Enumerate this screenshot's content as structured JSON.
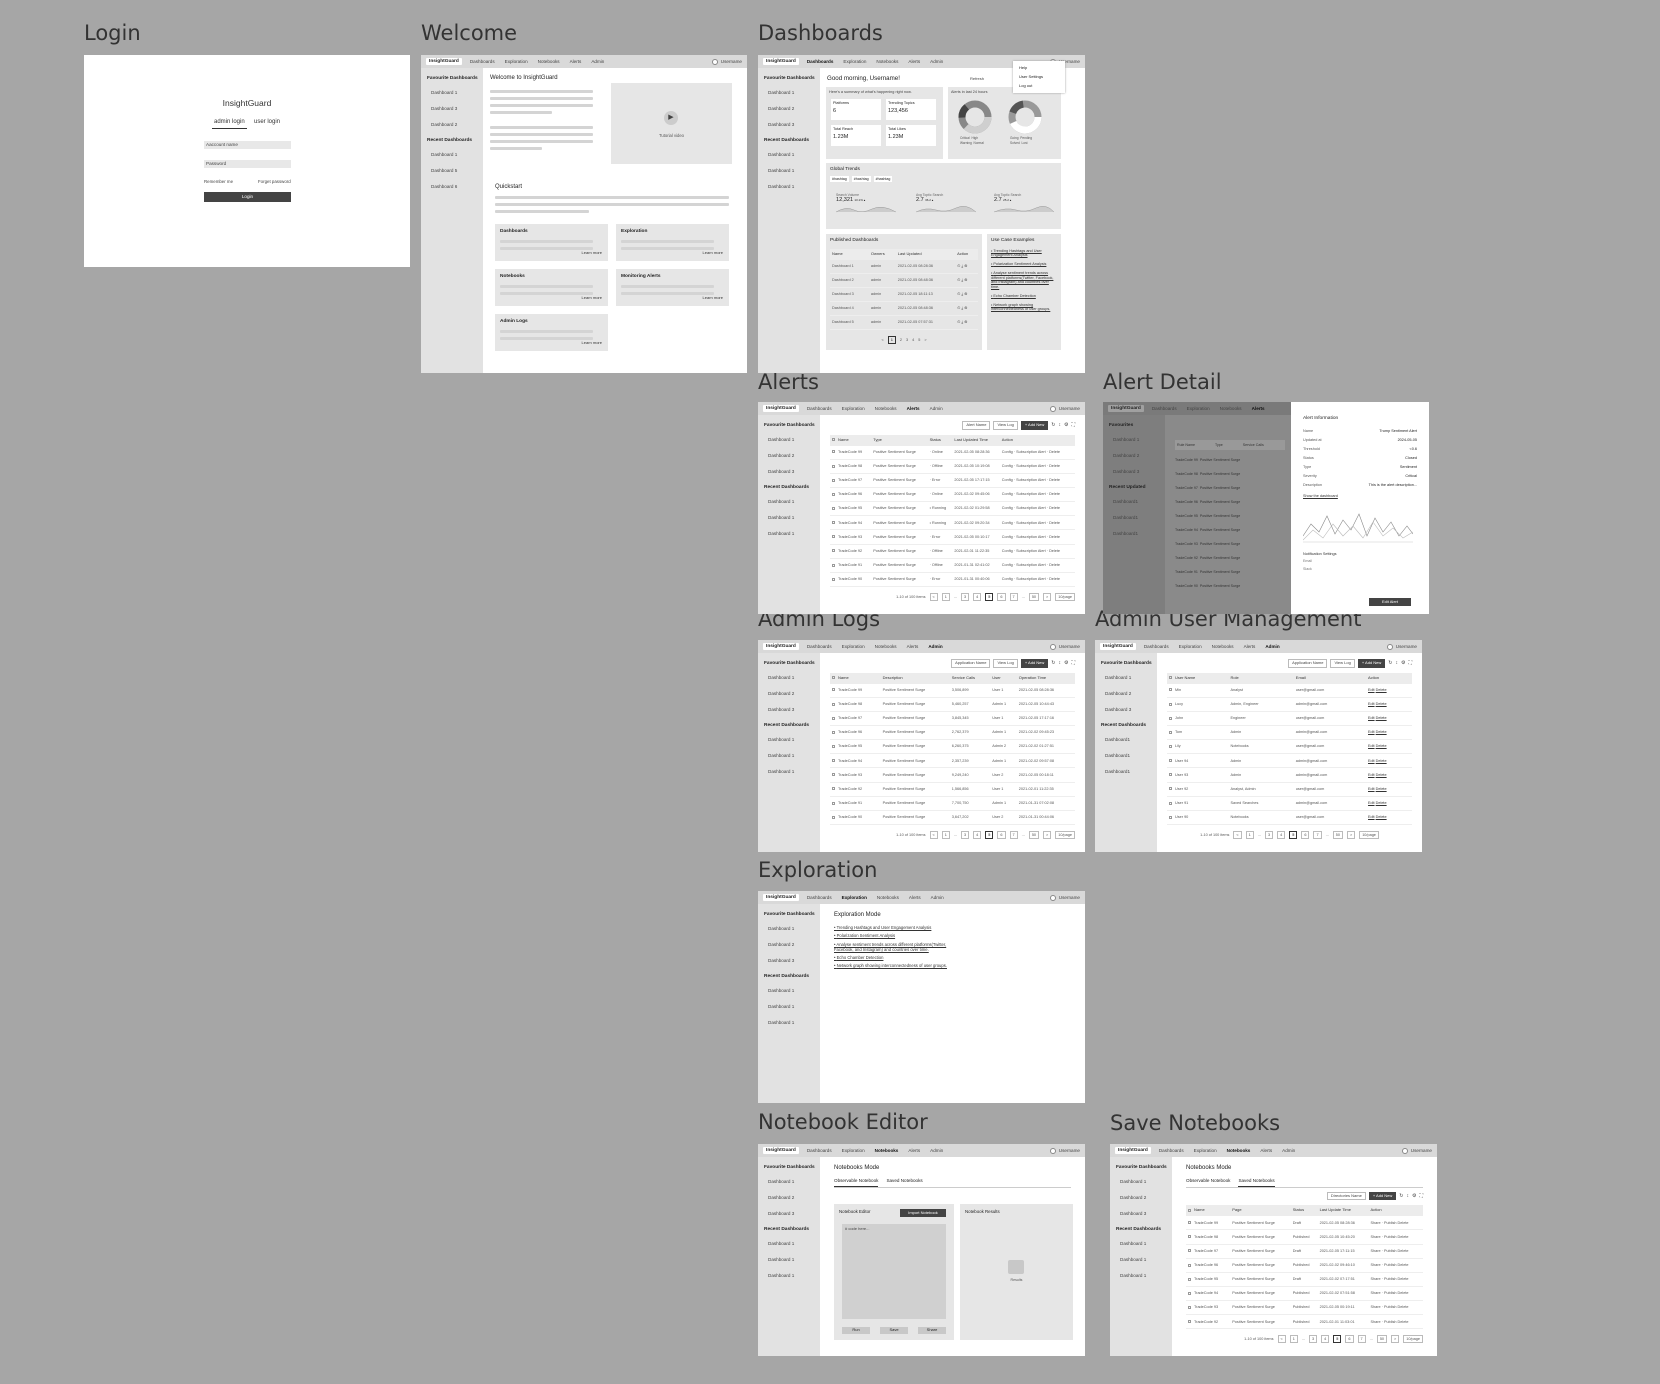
{
  "labels": {
    "login": "Login",
    "welcome": "Welcome",
    "dashboards": "Dashboards",
    "alerts": "Alerts",
    "alert_detail": "Alert Detail",
    "admin_logs": "Admin Logs",
    "admin_users": "Admin User Management",
    "exploration": "Exploration",
    "notebook_editor": "Notebook Editor",
    "save_notebooks": "Save Notebooks"
  },
  "app": {
    "name": "InsightGuard",
    "nav": [
      "Dashboards",
      "Exploration",
      "Notebooks",
      "Alerts",
      "Admin"
    ],
    "user": "Username"
  },
  "sidebar": {
    "fav_head": "Favourite Dashboards",
    "fav": [
      "Dashboard 1",
      "Dashboard 2",
      "Dashboard 3"
    ],
    "recent_head": "Recent Dashboards",
    "recent": [
      "Dashboard 1",
      "Dashboard 1",
      "Dashboard 1"
    ]
  },
  "login": {
    "title": "InsightGuard",
    "tab_admin": "admin login",
    "tab_user": "user login",
    "account_placeholder": "Aaccount name",
    "password_placeholder": "Password",
    "remember": "Remember me",
    "forgot": "Forget password",
    "button": "Login"
  },
  "welcome": {
    "heading": "Welcome to InsightGuard",
    "video": "Tutorial video",
    "quickstart": "Quickstart",
    "cards": [
      "Dashboards",
      "Exploration",
      "Notebooks",
      "Monitoring Alerts",
      "Admin Logs"
    ],
    "learn": "Learn more",
    "recent": [
      "Dashboard 1",
      "Dashboard 5",
      "Dashboard 6"
    ]
  },
  "dash": {
    "greeting": "Good morning, Username!",
    "summary": "Here's a summary of what's happening right now.",
    "alerts24": "Alerts in last 24 hours",
    "refresh": "Refresh",
    "menu": [
      "Help",
      "User Settings",
      "Log out"
    ],
    "stats": [
      {
        "label": "Platforms",
        "value": "6"
      },
      {
        "label": "Trending Topics",
        "value": "123,456"
      },
      {
        "label": "Total Reach",
        "value": "1.23M"
      },
      {
        "label": "Total Likes",
        "value": "1.23M"
      }
    ],
    "legend1": [
      "Critical",
      "High",
      "Warning",
      "Normal"
    ],
    "legend2": [
      "Going",
      "Pending",
      "Solved",
      "Lost"
    ],
    "trends_title": "Global Trends",
    "tags": [
      "#hashtag",
      "#hashtag",
      "#hashtag"
    ],
    "trend_metrics": [
      {
        "label": "Search Volume",
        "value": "12,321",
        "delta": "13.1% ▴"
      },
      {
        "label": "Avg Toptic Search",
        "value": "2.7",
        "delta": "36.2 ▴"
      },
      {
        "label": "Avg Toptic Search",
        "value": "2.7",
        "delta": "25.2 ▴"
      }
    ],
    "published": "Published Dashboards",
    "pub_cols": [
      "Name",
      "Owners",
      "Last Updated",
      "Action"
    ],
    "pub_rows": [
      [
        "Dashboard 1",
        "admin",
        "2021-02-05 08:28:36"
      ],
      [
        "Dashboard 2",
        "admin",
        "2021-02-05 08:48:36"
      ],
      [
        "Dashboard 3",
        "admin",
        "2021-02-05 18:11:13"
      ],
      [
        "Dashboard 4",
        "admin",
        "2021-02-05 08:48:36"
      ],
      [
        "Dashboard 5",
        "admin",
        "2021-02-05 07:57:31"
      ]
    ],
    "pages": [
      "<",
      "1",
      "2",
      "3",
      "4",
      "5",
      ">"
    ],
    "use_cases_title": "Use Case Examples",
    "use_cases": [
      "Trending Hashtags and User Engagement Analysis",
      "Polarization Sentiment Analysis",
      "Analyse sentiment trends across different platforms(Twitter, Facebook, and Instagram) and countries over time.",
      "Echo Chamber Detection",
      "Network graph showing interconnectedness of user groups."
    ]
  },
  "alerts": {
    "filter": "Alert Name",
    "view": "View Log",
    "add": "+ Add New",
    "cols": [
      "Name",
      "Type",
      "Status",
      "Last Updated Time",
      "Action"
    ],
    "rows": [
      [
        "TradeCode 99",
        "Positive Sentiment Surge",
        "Online",
        "2021-02-05 08:28:36",
        "Config · Subscription Alert · Delete"
      ],
      [
        "TradeCode 98",
        "Positive Sentiment Surge",
        "Offline",
        "2021-02-05 10:19:08",
        "Config · Subscription Alert · Delete"
      ],
      [
        "TradeCode 97",
        "Positive Sentiment Surge",
        "Error",
        "2021-02-05 17:17:15",
        "Config · Subscription Alert · Delete"
      ],
      [
        "TradeCode 96",
        "Positive Sentiment Surge",
        "Online",
        "2021-02-02 09:45:06",
        "Config · Subscription Alert · Delete"
      ],
      [
        "TradeCode 95",
        "Positive Sentiment Surge",
        "Running",
        "2021-02-02 01:29:58",
        "Config · Subscription Alert · Delete"
      ],
      [
        "TradeCode 94",
        "Positive Sentiment Surge",
        "Running",
        "2021-02-02 09:20:34",
        "Config · Subscription Alert · Delete"
      ],
      [
        "TradeCode 93",
        "Positive Sentiment Surge",
        "Error",
        "2021-02-05 00:10:17",
        "Config · Subscription Alert · Delete"
      ],
      [
        "TradeCode 92",
        "Positive Sentiment Surge",
        "Offline",
        "2021-02-01 11:22:35",
        "Config · Subscription Alert · Delete"
      ],
      [
        "TradeCode 91",
        "Positive Sentiment Surge",
        "Offline",
        "2021-01-31 02:41:02",
        "Config · Subscription Alert · Delete"
      ],
      [
        "TradeCode 90",
        "Positive Sentiment Surge",
        "Error",
        "2021-01-31 00:40:06",
        "Config · Subscription Alert · Delete"
      ]
    ],
    "total": "1-10 of 100 items",
    "pages": [
      "<",
      "1",
      "...",
      "3",
      "4",
      "5",
      "6",
      "7",
      "...",
      "50",
      ">"
    ],
    "perpage": "10/page"
  },
  "detail": {
    "title": "Alert Information",
    "fields": [
      [
        "Name",
        "Trump Sentiment Alert"
      ],
      [
        "Updated at",
        "2024-05-05"
      ],
      [
        "Threshold",
        "<0.6"
      ],
      [
        "Status",
        "Closed"
      ],
      [
        "Type",
        "Sentiment"
      ],
      [
        "Severity",
        "Critical"
      ],
      [
        "Description",
        "This is the alert description..."
      ]
    ],
    "link": "Show the dashboard",
    "notif": "Notification Settings",
    "email": "Email",
    "slack": "Slack",
    "edit": "Edit Alert",
    "side_fav": "Favourites",
    "side_recent": "Recent Updated",
    "recent": [
      "Dashboard1",
      "Dashboard1",
      "Dashboard1"
    ],
    "cols": [
      "Rule Name",
      "Type",
      "Service Calls"
    ]
  },
  "logs": {
    "filter": "Application Name",
    "view": "View Log",
    "add": "+ Add New",
    "cols": [
      "Name",
      "Description",
      "Service Calls",
      "User",
      "Operation Time"
    ],
    "rows": [
      [
        "TradeCode 99",
        "Positive Sentiment Surge",
        "3,506,899",
        "User 1",
        "2021-02-05 08:28:36"
      ],
      [
        "TradeCode 98",
        "Positive Sentiment Surge",
        "5,460,257",
        "Admin 1",
        "2021-02-05 10:44:43"
      ],
      [
        "TradeCode 97",
        "Positive Sentiment Surge",
        "3,845,345",
        "User 1",
        "2021-02-05 17:17:16"
      ],
      [
        "TradeCode 96",
        "Positive Sentiment Surge",
        "2,762,379",
        "Admin 1",
        "2021-02-02 09:45:23"
      ],
      [
        "TradeCode 95",
        "Positive Sentiment Surge",
        "6,260,375",
        "Admin 2",
        "2021-02-02 01:27:51"
      ],
      [
        "TradeCode 94",
        "Positive Sentiment Surge",
        "2,357,239",
        "Admin 1",
        "2021-02-02 09:57:08"
      ],
      [
        "TradeCode 93",
        "Positive Sentiment Surge",
        "9,249,240",
        "User 2",
        "2021-02-05 00:18:11"
      ],
      [
        "TradeCode 92",
        "Positive Sentiment Surge",
        "1,566,856",
        "User 1",
        "2021-02-01 11:22:35"
      ],
      [
        "TradeCode 91",
        "Positive Sentiment Surge",
        "7,700,750",
        "Admin 1",
        "2021-01-31 07:02:08"
      ],
      [
        "TradeCode 90",
        "Positive Sentiment Surge",
        "3,647,202",
        "User 2",
        "2021-01-31 00:44:06"
      ]
    ],
    "total": "1-10 of 100 items",
    "pages": [
      "<",
      "1",
      "...",
      "3",
      "4",
      "5",
      "6",
      "7",
      "...",
      "50",
      ">"
    ],
    "perpage": "10/page"
  },
  "users": {
    "filter": "Application Name",
    "view": "View Log",
    "add": "+ Add New",
    "cols": [
      "User Name",
      "Role",
      "Email",
      "Action"
    ],
    "rows": [
      [
        "Min",
        "Analyst",
        "user@gmail.com"
      ],
      [
        "Lucy",
        "Admin, Engineer",
        "admin@gmail.com"
      ],
      [
        "John",
        "Engineer",
        "user@gmail.com"
      ],
      [
        "Tom",
        "Admin",
        "admin@gmail.com"
      ],
      [
        "Lily",
        "Notebooks",
        "user@gmail.com"
      ],
      [
        "User 94",
        "Admin",
        "admin@gmail.com"
      ],
      [
        "User 93",
        "Admin",
        "admin@gmail.com"
      ],
      [
        "User 92",
        "Analyst, Admin",
        "user@gmail.com"
      ],
      [
        "User 91",
        "Saved Searches",
        "admin@gmail.com"
      ],
      [
        "User 90",
        "Notebooks",
        "user@gmail.com"
      ]
    ],
    "edit": "Edit",
    "delete": "Delete",
    "side_recent": [
      "Dashboard1",
      "Dashboard1",
      "Dashboard1"
    ],
    "total": "1-10 of 100 items",
    "pages": [
      "<",
      "1",
      "...",
      "3",
      "4",
      "5",
      "6",
      "7",
      "...",
      "50",
      ">"
    ],
    "perpage": "10/page"
  },
  "explore": {
    "title": "Exploration Mode",
    "items": [
      "Trending Hashtags and User Engagement Analysis",
      "Polarization Sentiment Analysis",
      "Analyse sentiment trends across different platforms(Twitter, Facebook, and Instagram) and countries over time.",
      "Echo Chamber Detection",
      "Network graph showing interconnectedness of user groups."
    ]
  },
  "notebook": {
    "title": "Notebooks Mode",
    "tab1": "Observable Notebook",
    "tab2": "Saved Notebooks",
    "editor": "Notebook Editor",
    "import": "Import Notebook",
    "code": "# code here...",
    "results": "Notebook Results",
    "results_label": "Results",
    "run": "Run",
    "save": "Save",
    "share": "Share"
  },
  "saved": {
    "filter": "Directories Name",
    "add": "+ Add New",
    "cols": [
      "Name",
      "Page",
      "Status",
      "Last Update Time",
      "Action"
    ],
    "rows": [
      [
        "TradeCode 99",
        "Positive Sentiment Surge",
        "Draft",
        "2021-02-05 08:28:36",
        "Share · Publish Delete"
      ],
      [
        "TradeCode 98",
        "Positive Sentiment Surge",
        "Published",
        "2021-02-05 10:45:20",
        "Share · Publish Delete"
      ],
      [
        "TradeCode 97",
        "Positive Sentiment Surge",
        "Draft",
        "2021-02-05 17:11:15",
        "Share · Publish Delete"
      ],
      [
        "TradeCode 96",
        "Positive Sentiment Surge",
        "Published",
        "2021-02-02 09:46:10",
        "Share · Publish Delete"
      ],
      [
        "TradeCode 95",
        "Positive Sentiment Surge",
        "Draft",
        "2021-02-02 07:17:51",
        "Share · Publish Delete"
      ],
      [
        "TradeCode 94",
        "Positive Sentiment Surge",
        "Published",
        "2021-02-02 07:51:58",
        "Share · Publish Delete"
      ],
      [
        "TradeCode 93",
        "Positive Sentiment Surge",
        "Published",
        "2021-02-05 00:19:11",
        "Share · Publish Delete"
      ],
      [
        "TradeCode 92",
        "Positive Sentiment Surge",
        "Published",
        "2021-02-01 11:03:01",
        "Share · Publish Delete"
      ]
    ],
    "total": "1-10 of 100 items",
    "pages": [
      "<",
      "1",
      "...",
      "3",
      "4",
      "5",
      "6",
      "7",
      "...",
      "50",
      ">"
    ],
    "perpage": "10/page"
  }
}
